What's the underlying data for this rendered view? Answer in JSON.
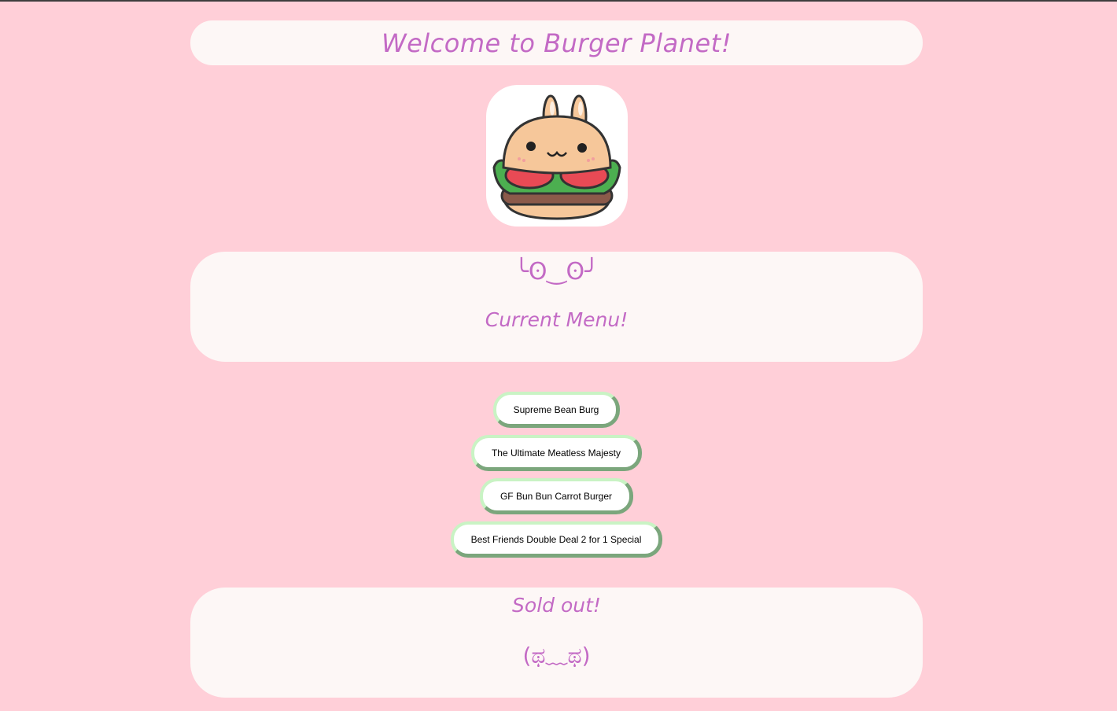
{
  "header": {
    "title": "Welcome to Burger Planet!"
  },
  "logo": {
    "icon": "bunny-burger-icon"
  },
  "menu_section": {
    "kaomoji": "╰ʘ‿ʘ╯",
    "heading": "Current Menu!"
  },
  "menu_items": [
    {
      "label": "Supreme Bean Burg"
    },
    {
      "label": "The Ultimate Meatless Majesty"
    },
    {
      "label": "GF Bun Bun Carrot Burger"
    },
    {
      "label": "Best Friends Double Deal 2 for 1 Special"
    }
  ],
  "soldout_section": {
    "heading": "Sold out!",
    "kaomoji": "(ಥ﹏ಥ)"
  },
  "colors": {
    "background": "#ffcfd8",
    "panel": "#fdf7f6",
    "accent_text": "#c36ac5",
    "button_light_border": "#c9f3c4",
    "button_dark_border": "#7ba67c"
  }
}
